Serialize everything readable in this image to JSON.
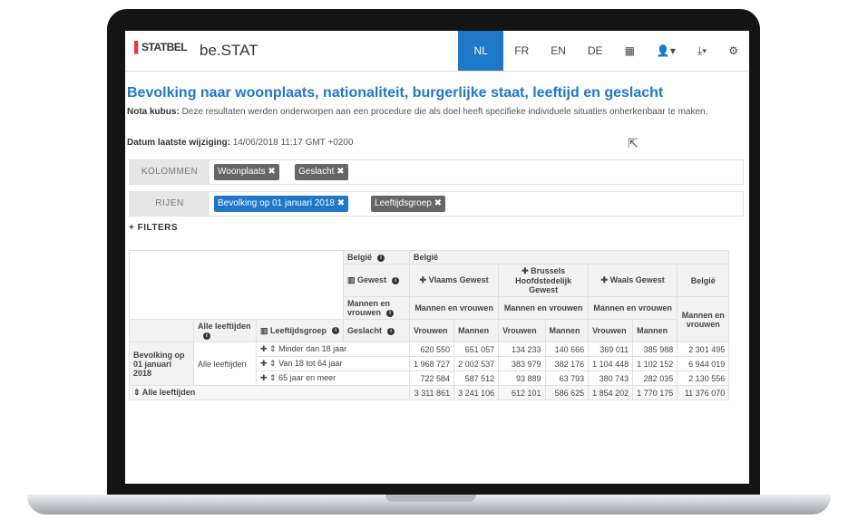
{
  "nav": {
    "logo": "STATBEL",
    "brand": "be.STAT",
    "languages": [
      "NL",
      "FR",
      "EN",
      "DE"
    ],
    "active_language": "NL",
    "icons": [
      "table-icon",
      "user-icon",
      "download-icon",
      "settings-icon"
    ]
  },
  "header": {
    "title": "Bevolking naar woonplaats, nationaliteit, burgerlijke staat, leeftijd en geslacht",
    "note_label": "Nota kubus:",
    "note_text": "Deze resultaten werden onderworpen aan een procedure die als doel heeft specifieke individuele situaties onherkenbaar te maken.",
    "date_label": "Datum laatste wijziging:",
    "date_value": "14/06/2018 11:17 GMT +0200"
  },
  "pivot": {
    "columns_label": "KOLOMMEN",
    "columns": [
      "Woonplaats ✖",
      "Geslacht ✖"
    ],
    "rows_label": "RIJEN",
    "rows": [
      "Bevolking op 01 januari 2018 ✖",
      "Leeftijdsgroep ✖"
    ],
    "filters_label": "+ FILTERS"
  },
  "table": {
    "h_belgie": "België",
    "h_belgie2": "België",
    "h_gewest": "Gewest",
    "h_vlaams": "✚ Vlaams Gewest",
    "h_brussels": "✚ Brussels Hoofdstedelijk Gewest",
    "h_waals": "✚ Waals Gewest",
    "h_belgie_total": "België",
    "h_mv_left": "Mannen en vrouwen",
    "h_mv1": "Mannen en vrouwen",
    "h_mv2": "Mannen en vrouwen",
    "h_mv3": "Mannen en vrouwen",
    "h_mv_total": "Mannen en vrouwen",
    "h_alle_leeftijden": "Alle leeftijden",
    "h_leeftijdsgroep": "Leeftijdsgroep",
    "h_geslacht": "Geslacht",
    "h_vrouwen": "Vrouwen",
    "h_mannen": "Mannen",
    "row_group": "Bevolking op 01 januari 2018",
    "row_subgroup": "Alle leeftijden",
    "rows": [
      {
        "label": "✚ ⇕ Minder dan 18 jaar",
        "values": [
          "620 550",
          "651 057",
          "134 233",
          "140 666",
          "369 011",
          "385 988",
          "2 301 495"
        ]
      },
      {
        "label": "✚ ⇕ Van 18 tot 64 jaar",
        "values": [
          "1 968 727",
          "2 002 537",
          "383 979",
          "382 176",
          "1 104 448",
          "1 102 152",
          "6 944 019"
        ]
      },
      {
        "label": "✚ ⇕ 65 jaar en meer",
        "values": [
          "722 584",
          "587 512",
          "93 889",
          "63 793",
          "380 743",
          "282 035",
          "2 130 556"
        ]
      }
    ],
    "total_row": {
      "label": "⇕ Alle leeftijden",
      "values": [
        "3 311 861",
        "3 241 106",
        "612 101",
        "586 625",
        "1 854 202",
        "1 770 175",
        "11 376 070"
      ]
    }
  }
}
